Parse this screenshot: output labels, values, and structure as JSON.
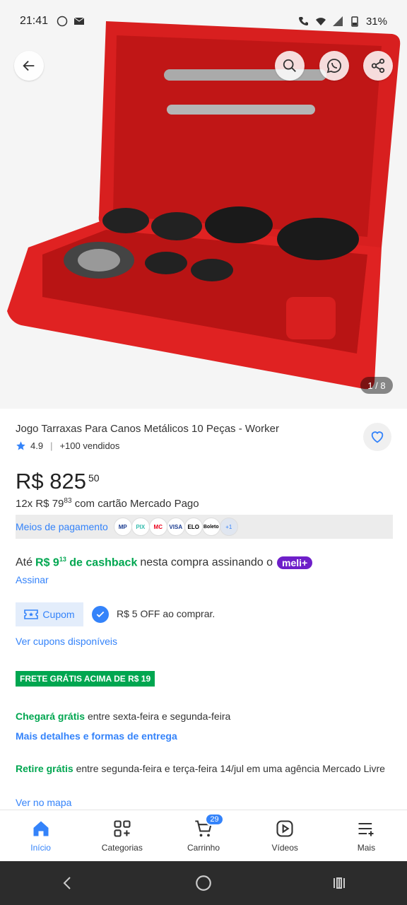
{
  "status_bar": {
    "time": "21:41",
    "battery": "31%"
  },
  "gallery": {
    "counter": "1 / 8"
  },
  "product": {
    "title": "Jogo Tarraxas Para Canos Metálicos 10 Peças - Worker",
    "rating": "4.9",
    "sold": "+100 vendidos",
    "price_currency": "R$",
    "price_integer": "825",
    "price_cents": "50",
    "installments_prefix": "12x R$ 79",
    "installments_cents": "83",
    "installments_suffix": "com cartão Mercado Pago"
  },
  "payments": {
    "label": "Meios de pagamento",
    "methods": [
      "MP",
      "PIX",
      "MC",
      "VISA",
      "ELO",
      "Boleto"
    ],
    "more": "+1"
  },
  "cashback": {
    "prefix": "Até",
    "amount": "R$ 9",
    "amount_cents": "13",
    "highlight": "de cashback",
    "suffix": "nesta compra assinando o",
    "badge": "meli+",
    "link": "Assinar"
  },
  "coupon": {
    "label": "Cupom",
    "text": "R$ 5 OFF ao comprar.",
    "link": "Ver cupons disponíveis"
  },
  "shipping": {
    "free_badge": "FRETE GRÁTIS ACIMA DE R$ 19",
    "arrival_highlight": "Chegará grátis",
    "arrival_rest": "entre sexta-feira e segunda-feira",
    "more_details": "Mais detalhes e formas de entrega",
    "pickup_highlight": "Retire grátis",
    "pickup_rest": "entre segunda-feira e terça-feira 14/jul em uma agência Mercado Livre",
    "map_link": "Ver no mapa"
  },
  "nav": {
    "items": [
      {
        "label": "Início",
        "icon": "home-icon"
      },
      {
        "label": "Categorias",
        "icon": "categories-icon"
      },
      {
        "label": "Carrinho",
        "icon": "cart-icon"
      },
      {
        "label": "Vídeos",
        "icon": "video-icon"
      },
      {
        "label": "Mais",
        "icon": "menu-icon"
      }
    ],
    "cart_count": "29"
  },
  "colors": {
    "accent": "#3483fa",
    "green": "#00a650",
    "meli": "#6e1fc9"
  }
}
